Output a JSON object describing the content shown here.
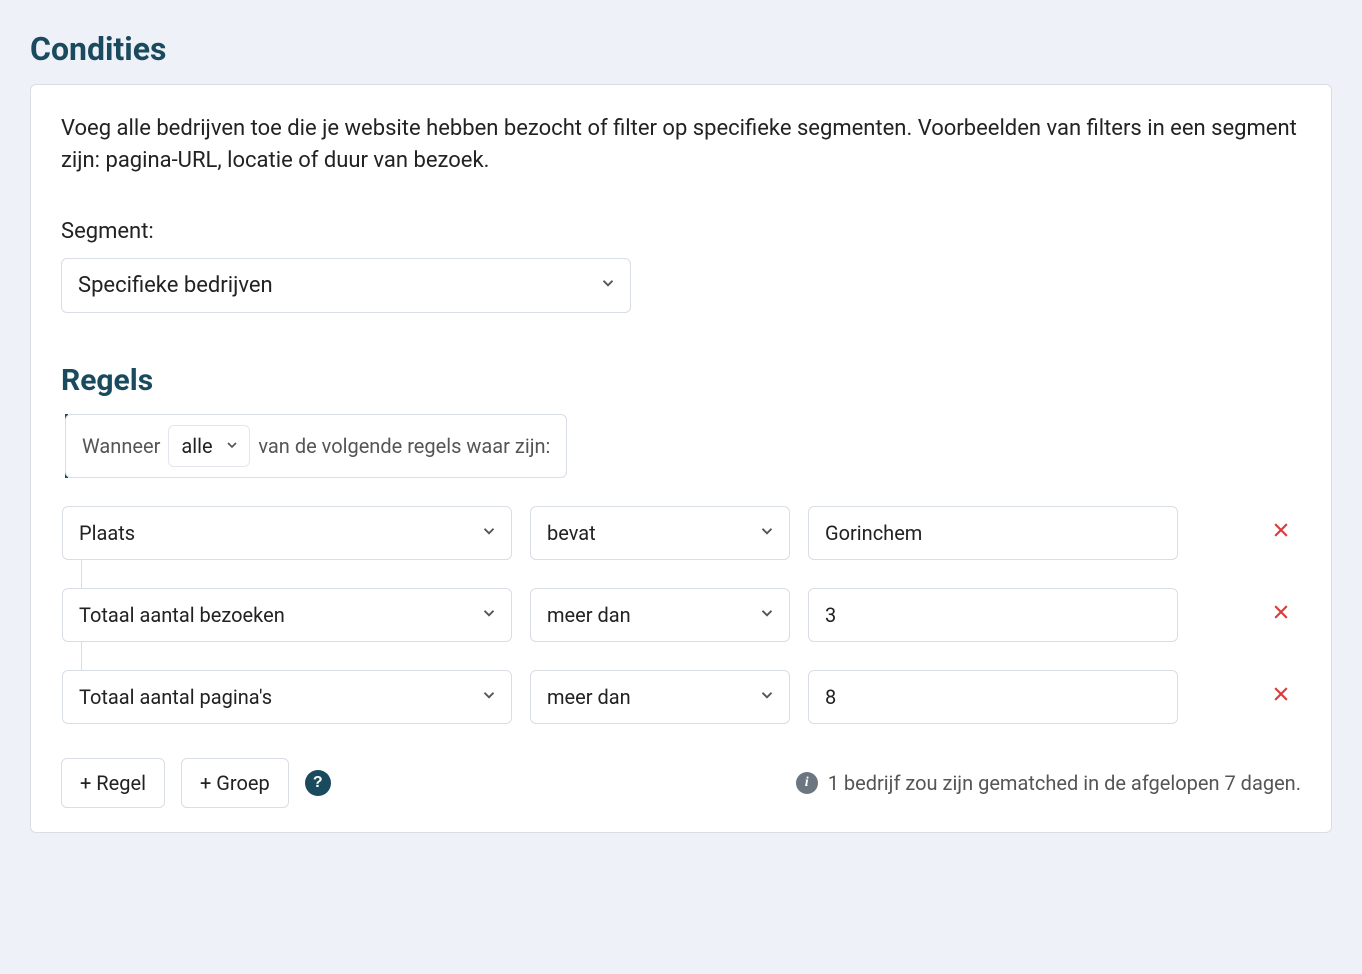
{
  "section_title": "Condities",
  "description": "Voeg alle bedrijven toe die je website hebben bezocht of filter op specifieke segmenten. Voorbeelden van filters in een segment zijn: pagina-URL, locatie of duur van bezoek.",
  "segment": {
    "label": "Segment:",
    "selected": "Specifieke bedrijven"
  },
  "rules_title": "Regels",
  "when": {
    "prefix": "Wanneer",
    "operator_selected": "alle",
    "suffix": "van de volgende regels waar zijn:"
  },
  "rules": [
    {
      "field": "Plaats",
      "operator": "bevat",
      "value": "Gorinchem"
    },
    {
      "field": "Totaal aantal bezoeken",
      "operator": "meer dan",
      "value": "3"
    },
    {
      "field": "Totaal aantal pagina's",
      "operator": "meer dan",
      "value": "8"
    }
  ],
  "buttons": {
    "add_rule": "+ Regel",
    "add_group": "+ Groep"
  },
  "match_info": "1 bedrijf zou zijn gematched in de afgelopen 7 dagen.",
  "icons": {
    "help": "?",
    "info": "i"
  }
}
